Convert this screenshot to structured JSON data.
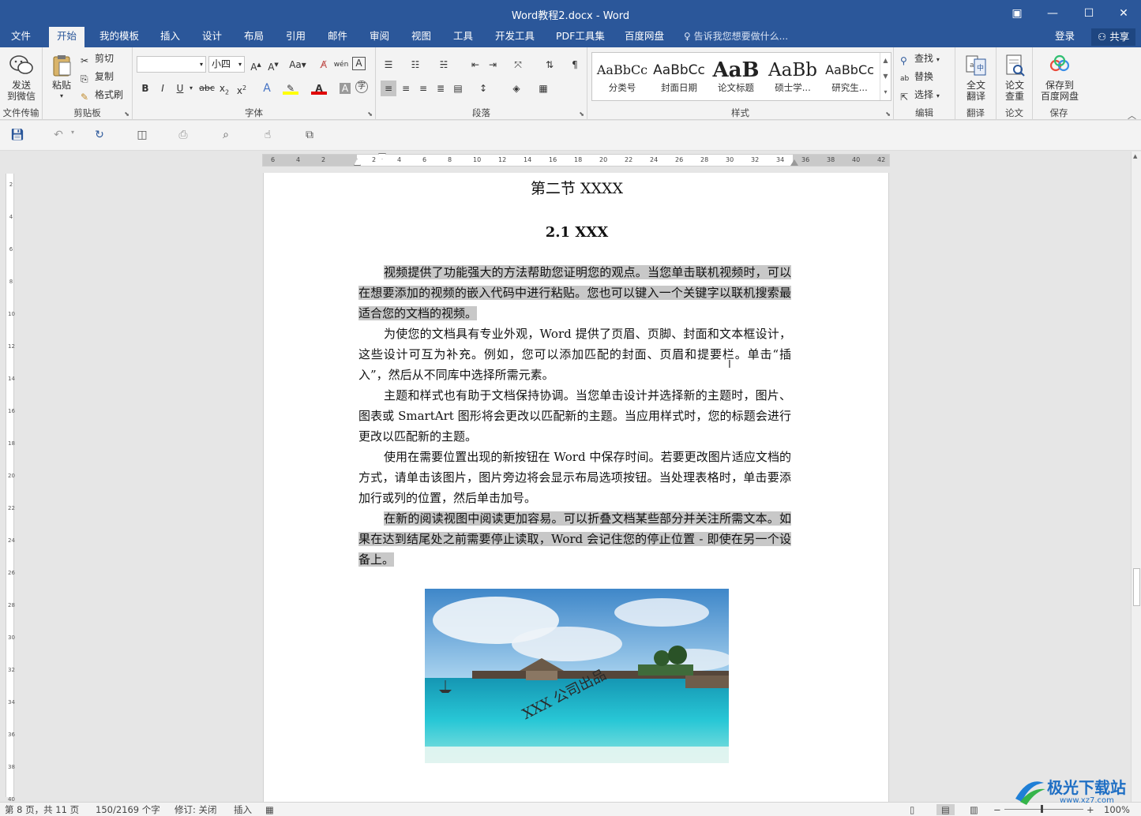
{
  "window": {
    "title": "Word教程2.docx - Word"
  },
  "tabs": [
    "文件",
    "开始",
    "我的模板",
    "插入",
    "设计",
    "布局",
    "引用",
    "邮件",
    "审阅",
    "视图",
    "工具",
    "开发工具",
    "PDF工具集",
    "百度网盘"
  ],
  "active_tab": "开始",
  "tell_me": "告诉我您想要做什么...",
  "account": {
    "login": "登录",
    "share": "共享"
  },
  "ribbon": {
    "send_wechat": "发送\n到微信",
    "group_file_transfer": "文件传输",
    "paste": "粘贴",
    "cut": "剪切",
    "copy": "复制",
    "format_painter": "格式刷",
    "group_clipboard": "剪贴板",
    "font_name": "",
    "font_size": "小四",
    "group_font": "字体",
    "group_paragraph": "段落",
    "styles": [
      {
        "preview": "AaBbCc",
        "name": "分类号"
      },
      {
        "preview": "AaBbCc",
        "name": "封面日期"
      },
      {
        "preview": "AaB",
        "name": "论文标题"
      },
      {
        "preview": "AaBb",
        "name": "硕士学..."
      },
      {
        "preview": "AaBbCc",
        "name": "研究生..."
      }
    ],
    "group_styles": "样式",
    "find": "查找",
    "replace": "替换",
    "select": "选择",
    "group_edit": "编辑",
    "full_translate": "全文\n翻译",
    "group_translate": "翻译",
    "paper_check": "论文\n查重",
    "group_paper": "论文",
    "save_baidu": "保存到\n百度网盘",
    "group_save": "保存"
  },
  "document": {
    "section_title": "第二节  XXXX",
    "sub_title": "2.1 XXX",
    "paragraphs": [
      "视频提供了功能强大的方法帮助您证明您的观点。当您单击联机视频时，可以在想要添加的视频的嵌入代码中进行粘贴。您也可以键入一个关键字以联机搜索最适合您的文档的视频。",
      "为使您的文档具有专业外观，Word 提供了页眉、页脚、封面和文本框设计，这些设计可互为补充。例如，您可以添加匹配的封面、页眉和提要栏。单击“插入”，然后从不同库中选择所需元素。",
      "主题和样式也有助于文档保持协调。当您单击设计并选择新的主题时，图片、图表或 SmartArt 图形将会更改以匹配新的主题。当应用样式时，您的标题会进行更改以匹配新的主题。",
      "使用在需要位置出现的新按钮在 Word 中保存时间。若要更改图片适应文档的方式，请单击该图片，图片旁边将会显示布局选项按钮。当处理表格时，单击要添加行或列的位置，然后单击加号。",
      "在新的阅读视图中阅读更加容易。可以折叠文档某些部分并关注所需文本。如果在达到结尾处之前需要停止读取，Word 会记住您的停止位置 - 即使在另一个设备上。"
    ],
    "highlighted": [
      true,
      false,
      false,
      false,
      true
    ],
    "image_watermark": "XXX 公司出品"
  },
  "status": {
    "page": "第 8 页，共 11 页",
    "words": "150/2169 个字",
    "track": "修订: 关闭",
    "mode": "插入",
    "zoom": "100%"
  },
  "watermark_logo": {
    "text": "极光下载站",
    "url": "www.xz7.com"
  }
}
